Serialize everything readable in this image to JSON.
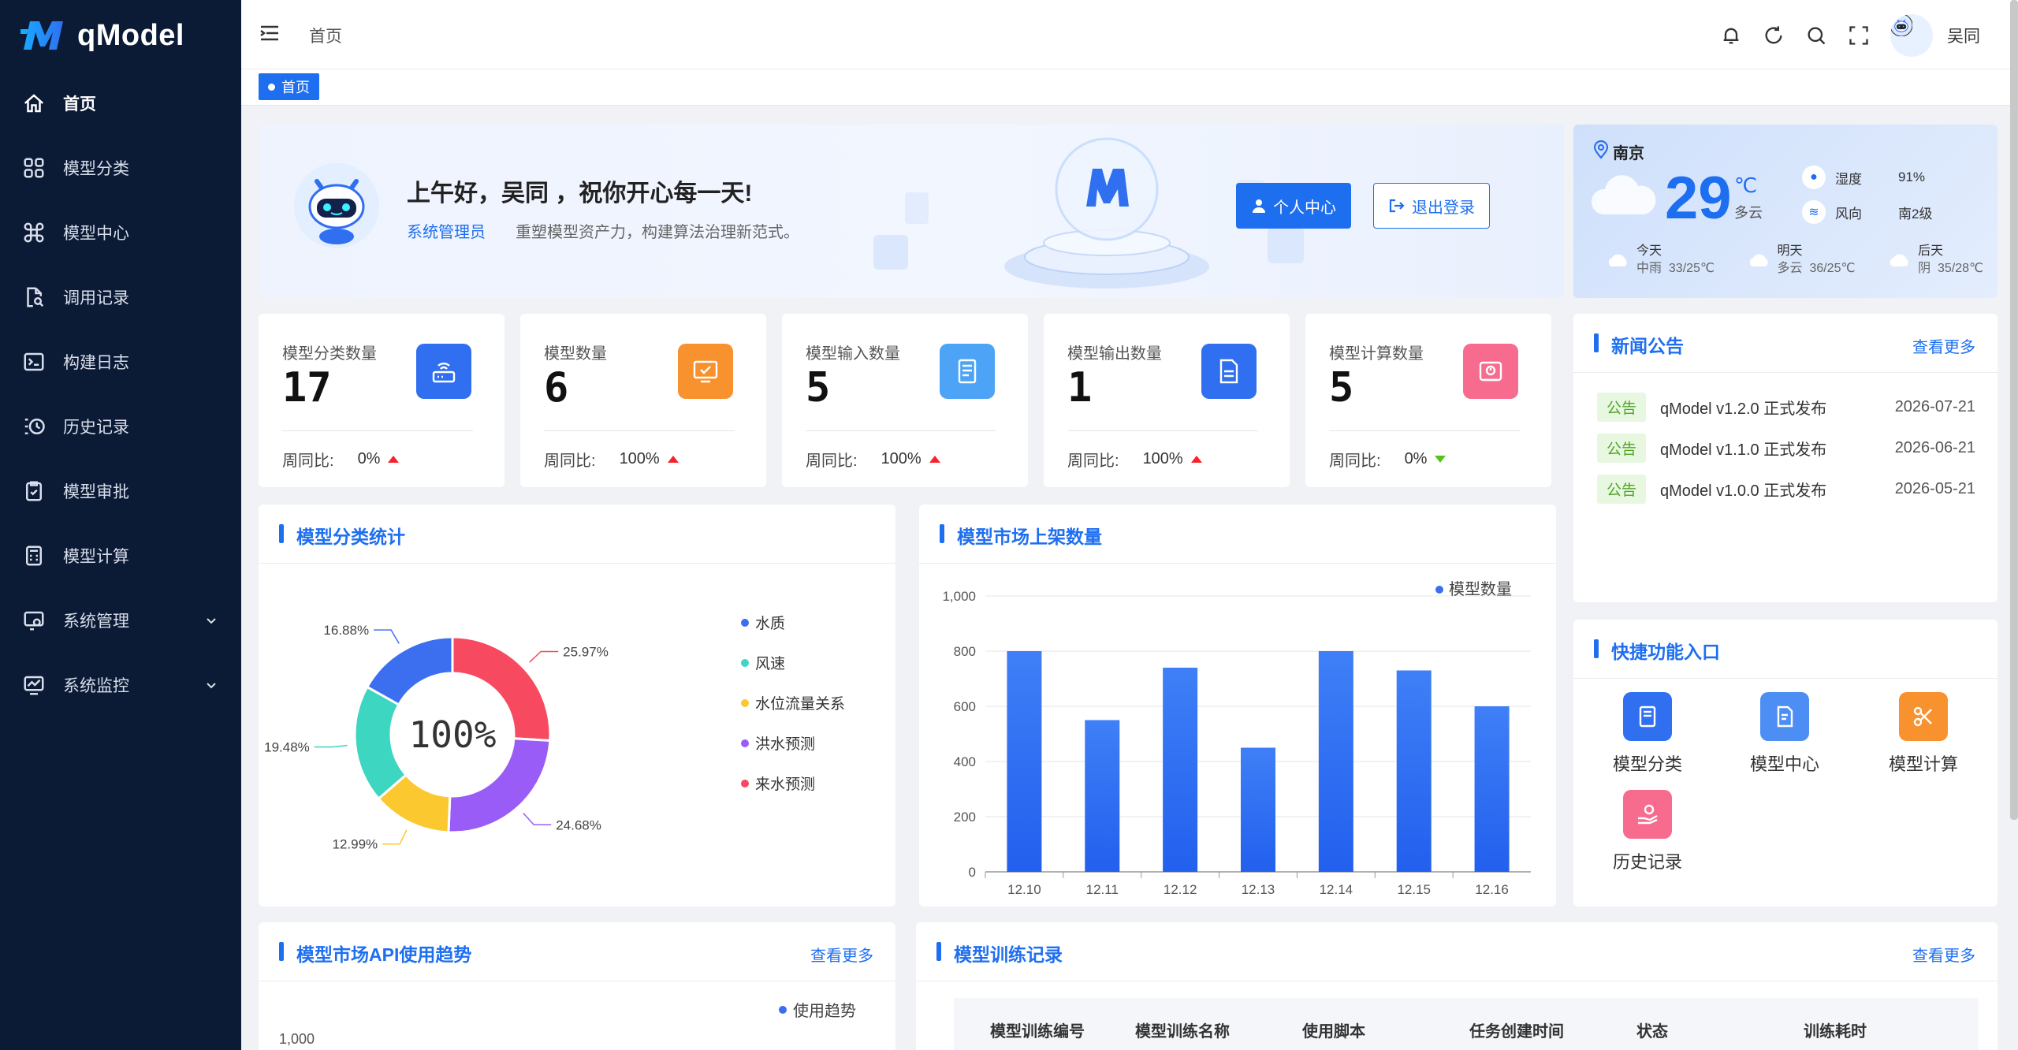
{
  "app": {
    "name": "qModel"
  },
  "sidebar": {
    "items": [
      {
        "label": "首页",
        "icon": "home-icon"
      },
      {
        "label": "模型分类",
        "icon": "grid-icon"
      },
      {
        "label": "模型中心",
        "icon": "command-icon"
      },
      {
        "label": "调用记录",
        "icon": "file-search-icon"
      },
      {
        "label": "构建日志",
        "icon": "terminal-icon"
      },
      {
        "label": "历史记录",
        "icon": "history-icon"
      },
      {
        "label": "模型审批",
        "icon": "check-clipboard-icon"
      },
      {
        "label": "模型计算",
        "icon": "calculator-icon"
      },
      {
        "label": "系统管理",
        "icon": "settings-monitor-icon"
      },
      {
        "label": "系统监控",
        "icon": "chart-monitor-icon"
      }
    ]
  },
  "header": {
    "breadcrumb": "首页",
    "user": "吴同"
  },
  "tags": {
    "home": "首页"
  },
  "welcome": {
    "greeting": "上午好，吴同 ，祝你开心每一天!",
    "role": "系统管理员",
    "slogan": "重塑模型资产力，构建算法治理新范式。",
    "btn_profile": "个人中心",
    "btn_logout": "退出登录"
  },
  "weather": {
    "city": "南京",
    "temp": "29",
    "unit": "℃",
    "condition": "多云",
    "humidity_label": "湿度",
    "humidity": "91%",
    "wind_label": "风向",
    "wind": "南2级",
    "days": [
      {
        "name": "今天",
        "cond": "中雨",
        "range": "33/25℃"
      },
      {
        "name": "明天",
        "cond": "多云",
        "range": "36/25℃"
      },
      {
        "name": "后天",
        "cond": "阴",
        "range": "35/28℃"
      }
    ]
  },
  "stats": [
    {
      "label": "模型分类数量",
      "value": "17",
      "week_label": "周同比:",
      "pct": "0%",
      "trend": "up",
      "color": "#2f6ff0"
    },
    {
      "label": "模型数量",
      "value": "6",
      "week_label": "周同比:",
      "pct": "100%",
      "trend": "up",
      "color": "#f7922e"
    },
    {
      "label": "模型输入数量",
      "value": "5",
      "week_label": "周同比:",
      "pct": "100%",
      "trend": "up",
      "color": "#4da3f5"
    },
    {
      "label": "模型输出数量",
      "value": "1",
      "week_label": "周同比:",
      "pct": "100%",
      "trend": "up",
      "color": "#2f6ff0"
    },
    {
      "label": "模型计算数量",
      "value": "5",
      "week_label": "周同比:",
      "pct": "0%",
      "trend": "down",
      "color": "#f76b8f"
    }
  ],
  "news": {
    "title": "新闻公告",
    "more": "查看更多",
    "items": [
      {
        "badge": "公告",
        "text": "qModel v1.2.0 正式发布",
        "date": "2026-07-21"
      },
      {
        "badge": "公告",
        "text": "qModel v1.1.0 正式发布",
        "date": "2026-06-21"
      },
      {
        "badge": "公告",
        "text": "qModel v1.0.0 正式发布",
        "date": "2026-05-21"
      }
    ]
  },
  "quick": {
    "title": "快捷功能入口",
    "items": [
      {
        "label": "模型分类",
        "color": "#2f6ff0"
      },
      {
        "label": "模型中心",
        "color": "#4d8ef5"
      },
      {
        "label": "模型计算",
        "color": "#f7922e"
      },
      {
        "label": "历史记录",
        "color": "#f76b8f"
      }
    ]
  },
  "donut": {
    "title": "模型分类统计",
    "center": "100%"
  },
  "bars": {
    "title": "模型市场上架数量"
  },
  "api": {
    "title": "模型市场API使用趋势",
    "more": "查看更多",
    "legend": "使用趋势",
    "ytop": "1,000"
  },
  "training": {
    "title": "模型训练记录",
    "more": "查看更多",
    "columns": [
      "模型训练编号",
      "模型训练名称",
      "使用脚本",
      "任务创建时间",
      "状态",
      "训练耗时"
    ]
  },
  "chart_data": [
    {
      "type": "pie",
      "title": "模型分类统计",
      "categories": [
        "水质",
        "风速",
        "水位流量关系",
        "洪水预测",
        "来水预测"
      ],
      "values": [
        16.88,
        19.48,
        12.99,
        24.68,
        25.97
      ],
      "labels": [
        "16.88%",
        "19.48%",
        "12.99%",
        "24.68%",
        "25.97%"
      ],
      "colors": [
        "#3b6ff0",
        "#3dd6c0",
        "#fcc830",
        "#9a5cf6",
        "#f74960"
      ],
      "legend": "right"
    },
    {
      "type": "bar",
      "title": "模型市场上架数量",
      "categories": [
        "12.10",
        "12.11",
        "12.12",
        "12.13",
        "12.14",
        "12.15",
        "12.16"
      ],
      "series": [
        {
          "name": "模型数量",
          "values": [
            800,
            550,
            740,
            450,
            800,
            730,
            600
          ]
        }
      ],
      "ylim": [
        0,
        1000
      ],
      "yticks": [
        "0",
        "200",
        "400",
        "600",
        "800",
        "1,000"
      ],
      "grid": true,
      "legend": "top-right"
    }
  ]
}
